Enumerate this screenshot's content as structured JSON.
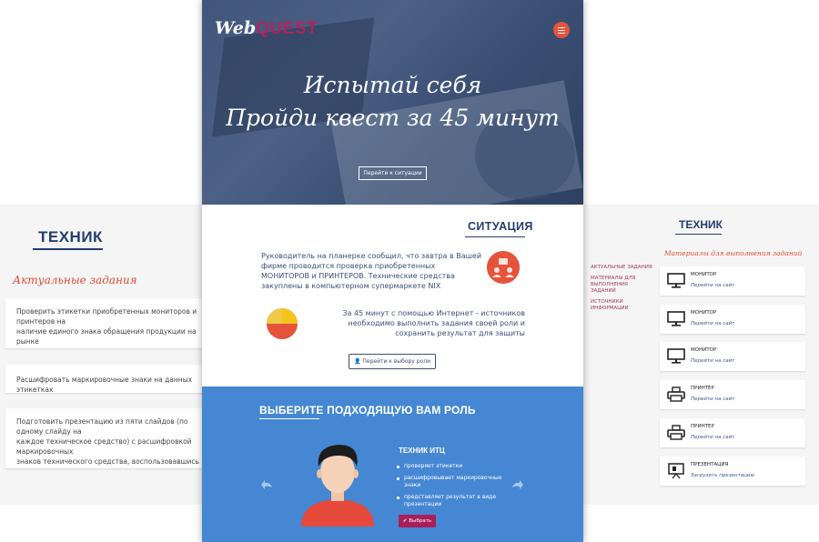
{
  "left": {
    "title": "ТЕХНИК",
    "subtitle": "Актуальные задания",
    "tasks": [
      "Проверить этикетки приобретенных мониторов и принтеров на\nналичие единого знака обращения продукции на рынке\nгосударств - членов Таможенного союза",
      "Расшифровать маркировочные знаки на данных этикетках",
      "Подготовить презентацию из пяти слайдов (по одному слайду на\nкаждое техническое средство) с расшифровкой маркировочных\nзнаков технического средства, воспользовавшись готовым\nшаблоном презентации"
    ]
  },
  "hero": {
    "logo_web": "Web",
    "logo_quest": "QUEST",
    "line1": "Испытай себя",
    "line2": "Пройди квест за 45 минут",
    "button": "Перейти к ситуации"
  },
  "situation": {
    "title": "СИТУАЦИЯ",
    "para1": "Руководитель на планерке сообщил, что завтра в Вашей фирме проводится проверка приобретенных МОНИТОРОВ и ПРИНТЕРОВ. Технические средства закуплены в компьютерном супермаркете NIX",
    "para2": "За 45 минут с помощью Интернет - источников необходимо выполнить задания своей роли и сохранить результат для защиты",
    "button": "Перейти к выбору роли"
  },
  "roles": {
    "title": "ВЫБЕРИТЕ ПОДХОДЯЩУЮ ВАМ РОЛЬ",
    "role_name": "ТЕХНИК ИТЦ",
    "duties": [
      "проверяет этикетки",
      "расшифровывает маркировочные знаки",
      "представляет результат в виде презентации"
    ],
    "choose_button": "Выбрать"
  },
  "right": {
    "title": "ТЕХНИК",
    "subtitle": "Материалы для выполнения заданий",
    "nav": [
      "АКТУАЛЬНЫЕ ЗАДАНИЯ",
      "МАТЕРИАЛЫ ДЛЯ ВЫПОЛНЕНИЯ ЗАДАНИЙ",
      "ИСТОЧНИКИ ИНФОРМАЦИИ"
    ],
    "resources": [
      {
        "name": "МОНИТОР",
        "link": "Перейти на сайт",
        "icon": "monitor-icon"
      },
      {
        "name": "МОНИТОР",
        "link": "Перейти на сайт",
        "icon": "monitor-icon"
      },
      {
        "name": "МОНИТОР",
        "link": "Перейти на сайт",
        "icon": "monitor-icon"
      },
      {
        "name": "ПРИНТЕР",
        "link": "Перейти на сайт",
        "icon": "printer-icon"
      },
      {
        "name": "ПРИНТЕР",
        "link": "Перейти на сайт",
        "icon": "printer-icon"
      },
      {
        "name": "ПРЕЗЕНТАЦИЯ",
        "link": "Загрузить презентацию",
        "icon": "presentation-icon"
      }
    ]
  },
  "colors": {
    "navy": "#243e6e",
    "accent_red": "#e4533a",
    "brand_magenta": "#a81f58",
    "role_blue": "#4587d3"
  }
}
